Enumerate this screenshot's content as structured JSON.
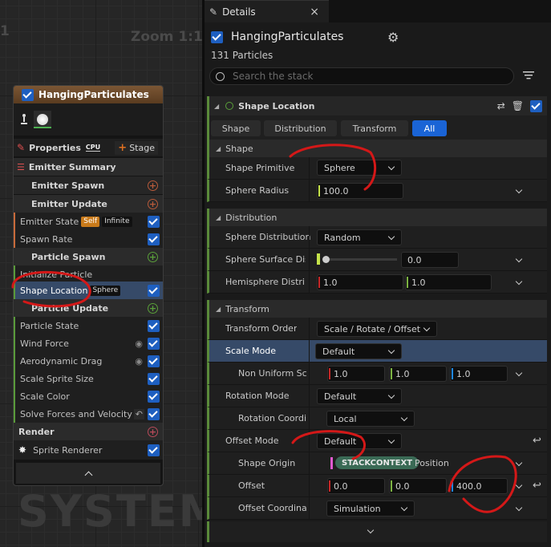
{
  "graph": {
    "zoom_label": "Zoom 1:1",
    "edge_marker": "1",
    "watermark": "SYSTEM",
    "node": {
      "title": "HangingParticulates",
      "properties_label": "Properties",
      "cpu_label": "CPU",
      "stage_label": "Stage",
      "emitter_summary_label": "Emitter Summary",
      "emitter_spawn_label": "Emitter Spawn",
      "emitter_update_label": "Emitter Update",
      "emitter_state_label": "Emitter State",
      "self_badge": "Self",
      "infinite_badge": "Infinite",
      "spawn_rate_label": "Spawn Rate",
      "particle_spawn_label": "Particle Spawn",
      "initialize_particle_label": "Initialize Particle",
      "shape_location_label": "Shape Location",
      "sphere_badge": "Sphere",
      "particle_update_label": "Particle Update",
      "particle_state_label": "Particle State",
      "wind_force_label": "Wind Force",
      "aerodynamic_drag_label": "Aerodynamic Drag",
      "scale_sprite_size_label": "Scale Sprite Size",
      "scale_color_label": "Scale Color",
      "solve_forces_label": "Solve Forces and Velocity",
      "render_label": "Render",
      "sprite_renderer_label": "Sprite Renderer"
    }
  },
  "details": {
    "tab_title": "Details",
    "close_glyph": "×",
    "emitter_name": "HangingParticulates",
    "particle_count": "131 Particles",
    "search_placeholder": "Search the stack",
    "module_title": "Shape Location",
    "filter_tabs": [
      "Shape",
      "Distribution",
      "Transform",
      "All"
    ],
    "active_tab": "All",
    "sections": {
      "shape": "Shape",
      "distribution": "Distribution",
      "transform": "Transform"
    },
    "props": {
      "shape_primitive_label": "Shape Primitive",
      "shape_primitive_value": "Sphere",
      "sphere_radius_label": "Sphere Radius",
      "sphere_radius_value": "100.0",
      "sphere_distribution_label": "Sphere Distribution",
      "sphere_distribution_value": "Random",
      "sphere_surface_label": "Sphere Surface Dist",
      "sphere_surface_value": "0.0",
      "hemisphere_label": "Hemisphere Distribı",
      "hemisphere_x": "1.0",
      "hemisphere_y": "1.0",
      "transform_order_label": "Transform Order",
      "transform_order_value": "Scale / Rotate / Offset",
      "scale_mode_label": "Scale Mode",
      "scale_mode_value": "Default",
      "non_uniform_label": "Non Uniform Sca",
      "non_uniform_x": "1.0",
      "non_uniform_y": "1.0",
      "non_uniform_z": "1.0",
      "rotation_mode_label": "Rotation Mode",
      "rotation_mode_value": "Default",
      "rotation_coord_label": "Rotation Coordin",
      "rotation_coord_value": "Local",
      "offset_mode_label": "Offset Mode",
      "offset_mode_value": "Default",
      "shape_origin_label": "Shape Origin",
      "shape_origin_pill": "STACKCONTEXT",
      "shape_origin_value": "Position",
      "offset_label": "Offset",
      "offset_x": "0.0",
      "offset_y": "0.0",
      "offset_z": "400.0",
      "offset_coord_label": "Offset Coordinat",
      "offset_coord_value": "Simulation"
    }
  },
  "colors": {
    "accent_blue": "#1e5fc0",
    "active_tab": "#1a64d6",
    "selected_row": "#364a68",
    "x_axis": "#c62828",
    "y_axis": "#7cb342",
    "z_axis": "#1e88e5",
    "float_color": "#c6e44a",
    "emitter_header": "#6b4a2a",
    "annotation_red": "#d41818"
  }
}
